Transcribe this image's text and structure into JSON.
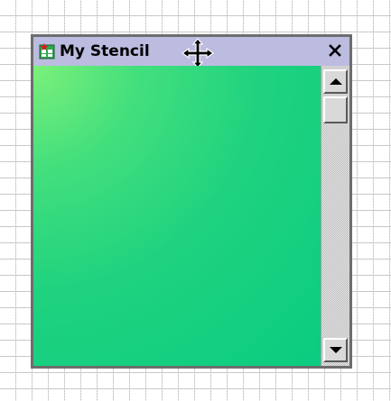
{
  "window": {
    "title": "My Stencil",
    "close_glyph": "✕",
    "icons": {
      "app": "stencil-app-icon",
      "move": "move-cursor-icon",
      "close": "close-icon",
      "scroll_up": "scroll-up-arrow-icon",
      "scroll_down": "scroll-down-arrow-icon"
    }
  },
  "scrollbar": {
    "position": 0
  },
  "colors": {
    "title_bar": "#bcbce0",
    "content_light": "#7cf07a",
    "content_dark": "#0acc80",
    "window_border": "#6d6d6d"
  }
}
